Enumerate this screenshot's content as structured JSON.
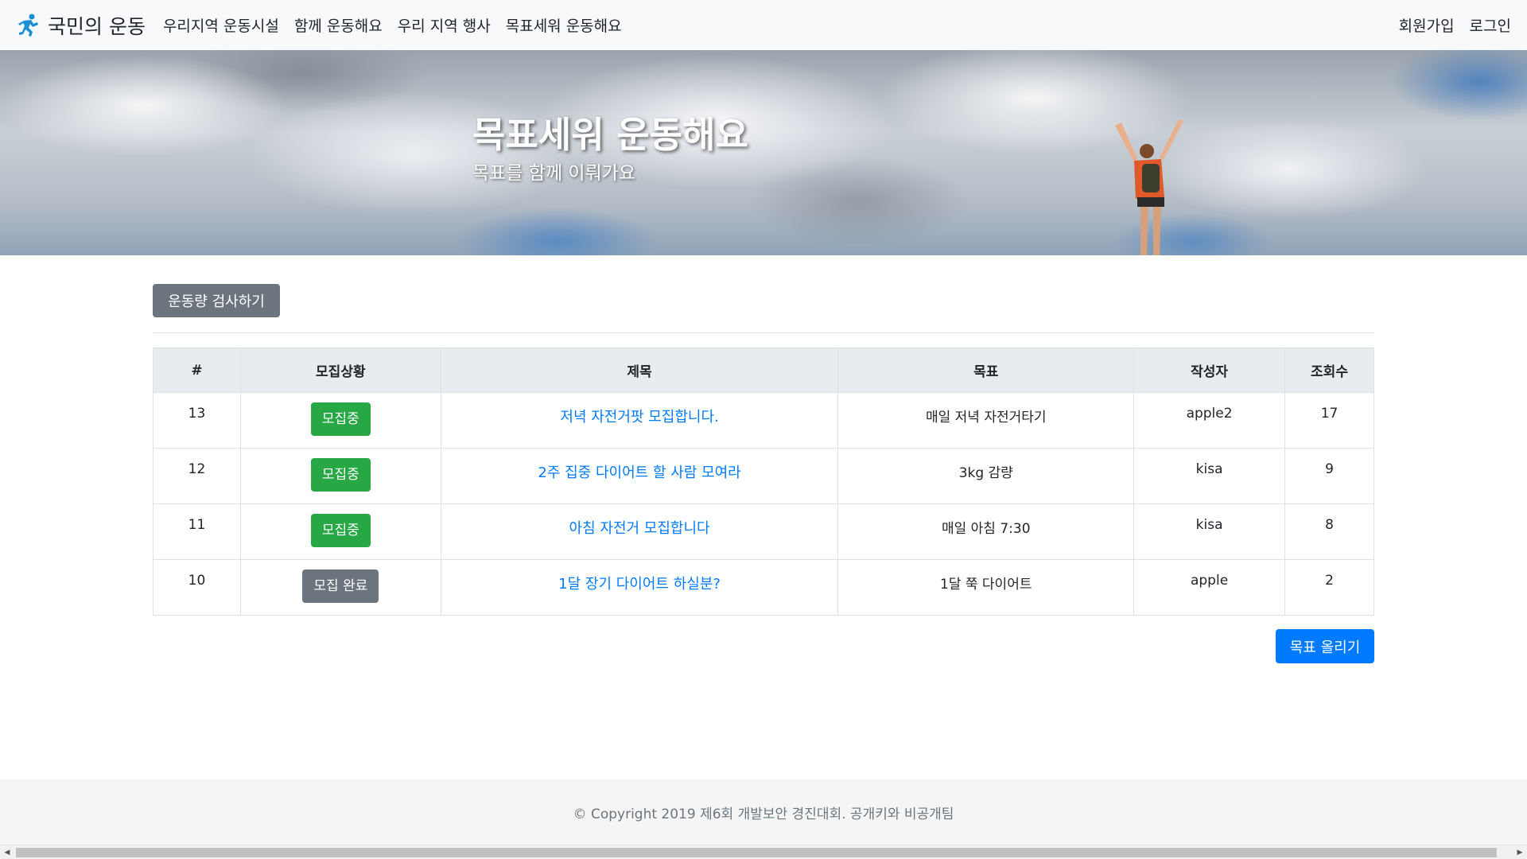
{
  "navbar": {
    "brand": "국민의 운동",
    "links": [
      "우리지역 운동시설",
      "함께 운동해요",
      "우리 지역 행사",
      "목표세워 운동해요"
    ],
    "signup": "회원가입",
    "login": "로그인",
    "brand_icon": "runner-icon"
  },
  "hero": {
    "title": "목표세워 운동해요",
    "subtitle": "목표를 함께 이뤄가요"
  },
  "actions": {
    "check_button": "운동량 검사하기",
    "post_button": "목표 올리기"
  },
  "table": {
    "headers": [
      "#",
      "모집상황",
      "제목",
      "목표",
      "작성자",
      "조회수"
    ],
    "rows": [
      {
        "no": "13",
        "status": "모집중",
        "status_type": "open",
        "title": "저녁 자전거팟 모집합니다.",
        "goal": "매일 저녁 자전거타기",
        "author": "apple2",
        "views": "17"
      },
      {
        "no": "12",
        "status": "모집중",
        "status_type": "open",
        "title": "2주 집중 다이어트 할 사람 모여라",
        "goal": "3kg 감량",
        "author": "kisa",
        "views": "9"
      },
      {
        "no": "11",
        "status": "모집중",
        "status_type": "open",
        "title": "아침 자전거 모집합니다",
        "goal": "매일 아침 7:30",
        "author": "kisa",
        "views": "8"
      },
      {
        "no": "10",
        "status": "모집 완료",
        "status_type": "closed",
        "title": "1달 장기 다이어트 하실분?",
        "goal": "1달 쭉 다이어트",
        "author": "apple",
        "views": "2"
      }
    ]
  },
  "footer": {
    "text": "© Copyright 2019 제6회 개발보안 경진대회. 공개키와 비공개팀"
  },
  "colors": {
    "primary": "#007bff",
    "success": "#28a745",
    "secondary": "#6c757d",
    "navbar_bg": "#f8f9fa"
  }
}
